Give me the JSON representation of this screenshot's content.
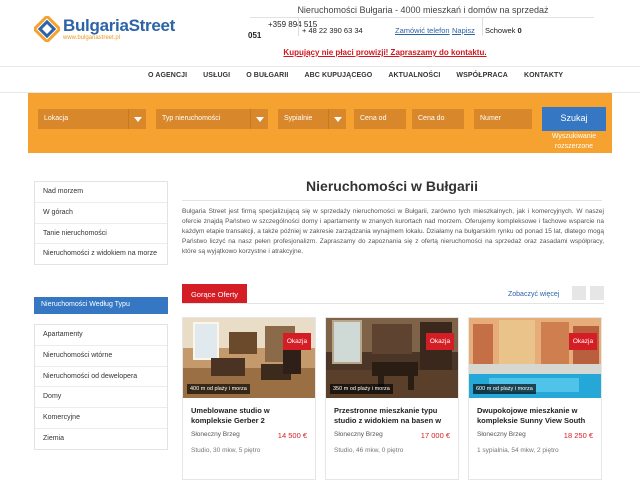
{
  "header": {
    "logo_name": "BulgariaStreet",
    "logo_url": "www.bulgariastreet.pl",
    "title": "Nieruchomości Bułgaria - 4000 mieszkań i domów na sprzedaż",
    "phone_main": "+359 894 515",
    "phone_main_cont": "051",
    "phone_pl": "+ 48 22 390 63 34",
    "call_link": "Zamówić telefon",
    "write_link": "Napisz",
    "clipboard_label": "Schowek",
    "clipboard_count": "0",
    "promo": "Kupujący nie płaci prowizji! Zapraszamy do kontaktu."
  },
  "nav": {
    "items": [
      "O AGENCJI",
      "USŁUGI",
      "O BUŁGARII",
      "ABC KUPUJĄCEGO",
      "AKTUALNOŚCI",
      "WSPÓŁPRACA",
      "KONTAKTY"
    ]
  },
  "search": {
    "location": "Lokacja",
    "type": "Typ nieruchomości",
    "bedrooms": "Sypialnie",
    "price_from": "Cena od",
    "price_to": "Cena do",
    "number": "Numer",
    "button": "Szukaj",
    "advanced": "Wyszukiwanie rozszerzone"
  },
  "sidebar": {
    "location_items": [
      "Nad morzem",
      "W górach",
      "Tanie nieruchomości",
      "Nieruchomości z widokiem na morze"
    ],
    "type_heading": "Nieruchomości Według Typu",
    "type_items": [
      "Apartamenty",
      "Nieruchomości wtórne",
      "Nieruchomości od dewelopera",
      "Domy",
      "Komercyjne",
      "Ziemia"
    ]
  },
  "main": {
    "title": "Nieruchomości w Bułgarii",
    "intro": "Bulgaria Street jest firmą specjalizującą się w sprzedaży nieruchomości w Bułgarii, zarówno tych mieszkalnych, jak i komercyjnych. W naszej ofercie znajdą Państwo w szczególności domy i apartamenty w znanych kurortach nad morzem. Oferujemy kompleksowe i fachowe wsparcie na każdym etapie transakcji, a także później w zakresie zarządzania wynajmem lokalu. Działamy na bułgarskim rynku od ponad 15 lat, dlatego mogą Państwo liczyć na nasz pełen profesjonalizm. Zapraszamy do zapoznania się z ofertą nieruchomości na sprzedaż oraz zasadami współpracy, które są wyjątkowo korzystne i atrakcyjne.",
    "hot_tab": "Gorące Oferty",
    "see_more": "Zobaczyć więcej"
  },
  "offers": [
    {
      "badge": "Okazja",
      "distance": "400 m od plaży i morza",
      "title": "Umeblowane studio w kompleksie Gerber 2",
      "location": "Słoneczny Brzeg",
      "price": "14 500 €",
      "spec": "Studio, 30 mkw, 5 piętro"
    },
    {
      "badge": "Okazja",
      "distance": "350 m od plaży i morza",
      "title": "Przestronne mieszkanie typu studio z widokiem na basen w",
      "location": "Słoneczny Brzeg",
      "price": "17 000 €",
      "spec": "Studio, 46 mkw, 0 piętro"
    },
    {
      "badge": "Okazja",
      "distance": "600 m od plaży i morza",
      "title": "Dwupokojowe mieszkanie w kompleksie Sunny View South",
      "location": "Słoneczny Brzeg",
      "price": "18 250 €",
      "spec": "1 sypialnia, 54 mkw, 2 piętro"
    }
  ],
  "colors": {
    "brand_blue": "#3677c3",
    "accent_orange": "#f5a230",
    "deal_red": "#d51d25"
  }
}
